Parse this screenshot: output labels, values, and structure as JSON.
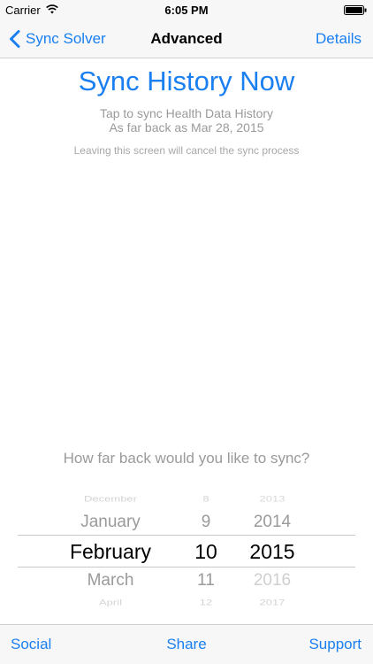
{
  "status_bar": {
    "carrier": "Carrier",
    "time": "6:05 PM",
    "wifi_icon": "wifi-icon",
    "battery_icon": "battery-full-icon"
  },
  "nav": {
    "back_label": "Sync Solver",
    "title": "Advanced",
    "right_label": "Details",
    "back_icon": "chevron-left-icon"
  },
  "main": {
    "headline": "Sync History Now",
    "subtitle_line1": "Tap to sync Health Data History",
    "subtitle_line2": "As far back as Mar 28, 2015",
    "warning": "Leaving this screen will cancel the sync process",
    "question": "How far back would you like to sync?"
  },
  "picker": {
    "months": [
      "December",
      "January",
      "February",
      "March",
      "April"
    ],
    "days": [
      "8",
      "9",
      "10",
      "11",
      "12"
    ],
    "years": [
      "2013",
      "2014",
      "2015",
      "2016",
      "2017"
    ],
    "selected": {
      "month": "February",
      "day": "10",
      "year": "2015"
    }
  },
  "toolbar": {
    "social": "Social",
    "share": "Share",
    "support": "Support"
  },
  "colors": {
    "accent": "#1a7ff0",
    "muted_text": "#9a9a9a",
    "bar_background": "#f7f7f7"
  }
}
